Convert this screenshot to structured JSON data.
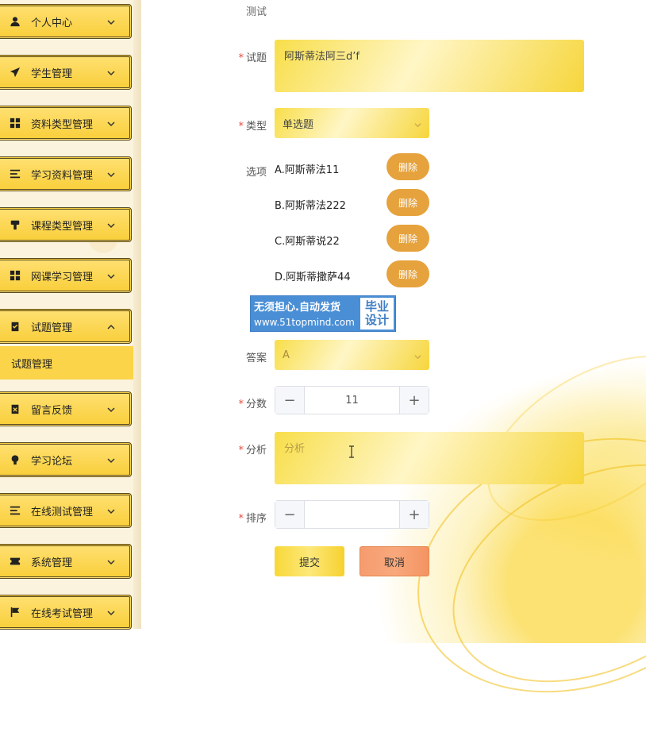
{
  "sidebar": {
    "items": [
      {
        "label": "个人中心",
        "icon": "user-icon",
        "expanded": false
      },
      {
        "label": "学生管理",
        "icon": "paper-plane-icon",
        "expanded": false
      },
      {
        "label": "资料类型管理",
        "icon": "grid-icon",
        "expanded": false
      },
      {
        "label": "学习资料管理",
        "icon": "list-icon",
        "expanded": false
      },
      {
        "label": "课程类型管理",
        "icon": "pin-icon",
        "expanded": false
      },
      {
        "label": "网课学习管理",
        "icon": "grid-icon",
        "expanded": false
      },
      {
        "label": "试题管理",
        "icon": "clipboard-check-icon",
        "expanded": true
      },
      {
        "label": "留言反馈",
        "icon": "clipboard-x-icon",
        "expanded": false
      },
      {
        "label": "学习论坛",
        "icon": "bulb-icon",
        "expanded": false
      },
      {
        "label": "在线测试管理",
        "icon": "list-icon",
        "expanded": false
      },
      {
        "label": "系统管理",
        "icon": "ticket-icon",
        "expanded": false
      },
      {
        "label": "在线考试管理",
        "icon": "flag-icon",
        "expanded": false
      }
    ],
    "submenu_label": "试题管理"
  },
  "form": {
    "top_value": "测试",
    "question": {
      "label": "试题",
      "value": "阿斯蒂法阿三d’f"
    },
    "type": {
      "label": "类型",
      "value": "单选题"
    },
    "options": {
      "label": "选项",
      "items": [
        "A.阿斯蒂法11",
        "B.阿斯蒂法222",
        "C.阿斯蒂说22",
        "D.阿斯蒂撒萨44"
      ],
      "delete_label": "删除"
    },
    "answer": {
      "label": "答案",
      "value": "A"
    },
    "score": {
      "label": "分数",
      "value": "11",
      "minus": "−",
      "plus": "+"
    },
    "analysis": {
      "label": "分析",
      "placeholder": "分析"
    },
    "order": {
      "label": "排序",
      "value": "",
      "minus": "−",
      "plus": "+"
    },
    "submit_label": "提交",
    "cancel_label": "取消"
  },
  "watermark": {
    "line1": "无须担心.自动发货",
    "line2": "www.51topmind.com",
    "badge1": "毕业",
    "badge2": "设计"
  },
  "colors": {
    "menu_yellow": "#f9cf3c",
    "delete_orange": "#e6a23c",
    "required_red": "#e74c3c",
    "cancel_orange": "#f5935e"
  }
}
